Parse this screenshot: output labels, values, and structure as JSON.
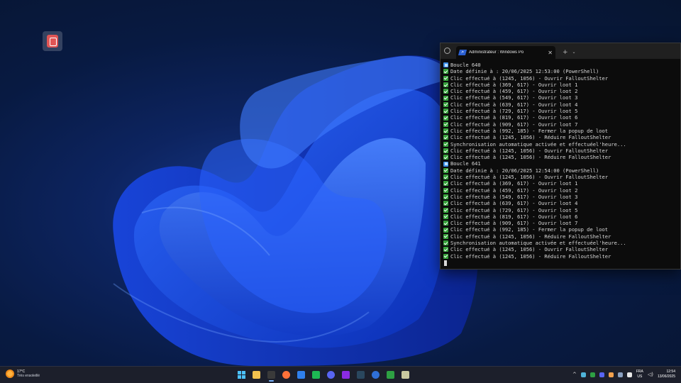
{
  "desktop": {
    "icon_name": "app-shortcut-icon"
  },
  "terminal": {
    "tab_title": "Administrateur : Windows Po",
    "new_tab_label": "+",
    "dropdown_label": "⌄",
    "close_label": "✕",
    "lines": [
      {
        "kind": "info",
        "text": "Boucle 640"
      },
      {
        "kind": "check",
        "text": "Date définie à : 20/06/2025 12:53:00 (PowerShell)"
      },
      {
        "kind": "check",
        "text": "Clic effectué à (1245, 1056) - Ouvrir FalloutShelter"
      },
      {
        "kind": "check",
        "text": "Clic effectué à (369, 617) - Ouvrir loot 1"
      },
      {
        "kind": "check",
        "text": "Clic effectué à (459, 617) - Ouvrir loot 2"
      },
      {
        "kind": "check",
        "text": "Clic effectué à (549, 617) - Ouvrir loot 3"
      },
      {
        "kind": "check",
        "text": "Clic effectué à (639, 617) - Ouvrir loot 4"
      },
      {
        "kind": "check",
        "text": "Clic effectué à (729, 617) - Ouvrir loot 5"
      },
      {
        "kind": "check",
        "text": "Clic effectué à (819, 617) - Ouvrir loot 6"
      },
      {
        "kind": "check",
        "text": "Clic effectué à (909, 617) - Ouvrir loot 7"
      },
      {
        "kind": "check",
        "text": "Clic effectué à (992, 185) - Fermer la popup de loot"
      },
      {
        "kind": "check",
        "text": "Clic effectué à (1245, 1056) - Réduire FalloutShelter"
      },
      {
        "kind": "check",
        "text": "Synchronisation automatique activée et effectuéel'heure..."
      },
      {
        "kind": "check",
        "text": "Clic effectué à (1245, 1056) - Ouvrir FalloutShelter"
      },
      {
        "kind": "check",
        "text": "Clic effectué à (1245, 1056) - Réduire FalloutShelter"
      },
      {
        "kind": "info",
        "text": "Boucle 641"
      },
      {
        "kind": "check",
        "text": "Date définie à : 20/06/2025 12:54:00 (PowerShell)"
      },
      {
        "kind": "check",
        "text": "Clic effectué à (1245, 1056) - Ouvrir FalloutShelter"
      },
      {
        "kind": "check",
        "text": "Clic effectué à (369, 617) - Ouvrir loot 1"
      },
      {
        "kind": "check",
        "text": "Clic effectué à (459, 617) - Ouvrir loot 2"
      },
      {
        "kind": "check",
        "text": "Clic effectué à (549, 617) - Ouvrir loot 3"
      },
      {
        "kind": "check",
        "text": "Clic effectué à (639, 617) - Ouvrir loot 4"
      },
      {
        "kind": "check",
        "text": "Clic effectué à (729, 617) - Ouvrir loot 5"
      },
      {
        "kind": "check",
        "text": "Clic effectué à (819, 617) - Ouvrir loot 6"
      },
      {
        "kind": "check",
        "text": "Clic effectué à (909, 617) - Ouvrir loot 7"
      },
      {
        "kind": "check",
        "text": "Clic effectué à (992, 185) - Fermer la popup de loot"
      },
      {
        "kind": "check",
        "text": "Clic effectué à (1245, 1056) - Réduire FalloutShelter"
      },
      {
        "kind": "check",
        "text": "Synchronisation automatique activée et effectuéel'heure..."
      },
      {
        "kind": "check",
        "text": "Clic effectué à (1245, 1056) - Ouvrir FalloutShelter"
      },
      {
        "kind": "check",
        "text": "Clic effectué à (1245, 1056) - Réduire FalloutShelter"
      }
    ]
  },
  "taskbar": {
    "weather": {
      "temp": "17°C",
      "condition": "Très ensoleillé"
    },
    "apps": [
      {
        "name": "start-button",
        "color": "#4cc2ff",
        "active": false
      },
      {
        "name": "file-explorer-icon",
        "color": "#f2c14e",
        "active": false
      },
      {
        "name": "terminal-icon",
        "color": "#3a3a3a",
        "active": true
      },
      {
        "name": "firefox-icon",
        "color": "#ff7139",
        "active": false
      },
      {
        "name": "vscode-icon",
        "color": "#2f80ed",
        "active": false
      },
      {
        "name": "spotify-icon",
        "color": "#1db954",
        "active": false
      },
      {
        "name": "discord-icon",
        "color": "#5865f2",
        "active": false
      },
      {
        "name": "obs-icon",
        "color": "#8a2be2",
        "active": false
      },
      {
        "name": "steam-icon",
        "color": "#2a475e",
        "active": false
      },
      {
        "name": "app-icon",
        "color": "#2f6fd6",
        "active": false
      },
      {
        "name": "github-desktop-icon",
        "color": "#2ea043",
        "active": false
      },
      {
        "name": "app-icon-2",
        "color": "#c9c9a0",
        "active": false
      }
    ],
    "tray_icons": [
      {
        "name": "tray-icon-1",
        "color": "#4fb3d9"
      },
      {
        "name": "tray-icon-2",
        "color": "#2ea043"
      },
      {
        "name": "tray-icon-3",
        "color": "#5865f2"
      },
      {
        "name": "tray-icon-4",
        "color": "#f2a14e"
      },
      {
        "name": "tray-icon-5",
        "color": "#8aa0c0"
      },
      {
        "name": "tray-icon-6",
        "color": "#e8e8e8"
      }
    ],
    "language": {
      "line1": "FRA",
      "line2": "US"
    },
    "clock": {
      "time": "12:54",
      "date": "13/06/2025"
    }
  }
}
